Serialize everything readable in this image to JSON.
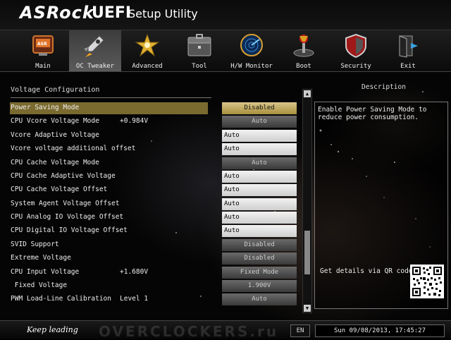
{
  "header": {
    "brand": "ASRock",
    "uefi": "UEFI",
    "title": "Setup Utility",
    "minimize": "",
    "close": ""
  },
  "nav": {
    "active_tab": "OC Tweaker",
    "tabs": [
      {
        "label": "Main",
        "icon": "main-icon"
      },
      {
        "label": "OC Tweaker",
        "icon": "rocket-icon"
      },
      {
        "label": "Advanced",
        "icon": "star-icon"
      },
      {
        "label": "Tool",
        "icon": "toolbox-icon"
      },
      {
        "label": "H/W Monitor",
        "icon": "radar-icon"
      },
      {
        "label": "Boot",
        "icon": "joystick-icon"
      },
      {
        "label": "Security",
        "icon": "shield-icon"
      },
      {
        "label": "Exit",
        "icon": "exit-door-icon"
      }
    ]
  },
  "section": {
    "title": "Voltage Configuration"
  },
  "settings": [
    {
      "name": "Power Saving Mode",
      "current": "",
      "value": "Disabled",
      "type": "select",
      "selected": true
    },
    {
      "name": "CPU Vcore Voltage Mode",
      "current": "+0.984V",
      "value": "Auto",
      "type": "select"
    },
    {
      "name": "Vcore Adaptive Voltage",
      "current": "",
      "value": "Auto",
      "type": "input"
    },
    {
      "name": "Vcore voltage additional offset",
      "current": "",
      "value": "Auto",
      "type": "input"
    },
    {
      "name": "CPU Cache Voltage Mode",
      "current": "",
      "value": "Auto",
      "type": "select"
    },
    {
      "name": "CPU Cache Adaptive Voltage",
      "current": "",
      "value": "Auto",
      "type": "input"
    },
    {
      "name": "CPU Cache Voltage Offset",
      "current": "",
      "value": "Auto",
      "type": "input"
    },
    {
      "name": "System Agent Voltage Offset",
      "current": "",
      "value": "Auto",
      "type": "input"
    },
    {
      "name": "CPU Analog IO Voltage Offset",
      "current": "",
      "value": "Auto",
      "type": "input"
    },
    {
      "name": "CPU Digital IO Voltage Offset",
      "current": "",
      "value": "Auto",
      "type": "input"
    },
    {
      "name": "SVID Support",
      "current": "",
      "value": "Disabled",
      "type": "select"
    },
    {
      "name": "Extreme Voltage",
      "current": "",
      "value": "Disabled",
      "type": "select"
    },
    {
      "name": "CPU Input Voltage",
      "current": "+1.680V",
      "value": "Fixed Mode",
      "type": "select"
    },
    {
      "name": " Fixed Voltage",
      "current": "",
      "value": "1.900V",
      "type": "select"
    },
    {
      "name": "PWM Load-Line Calibration",
      "current": "Level 1",
      "value": "Auto",
      "type": "select"
    }
  ],
  "description": {
    "title": "Description",
    "text": "Enable Power Saving Mode to reduce power consumption.",
    "qr_label": "Get details via QR code"
  },
  "footer": {
    "slogan": "Keep leading",
    "watermark": "OVERCLOCKERS.ru",
    "language": "EN",
    "datetime": "Sun 09/08/2013, 17:45:27"
  },
  "colors": {
    "highlight": "#7a6a2f",
    "selected_button": "#c8b46a",
    "input_bg": "#e6e6e6",
    "button_bg": "#4a4a4a"
  }
}
